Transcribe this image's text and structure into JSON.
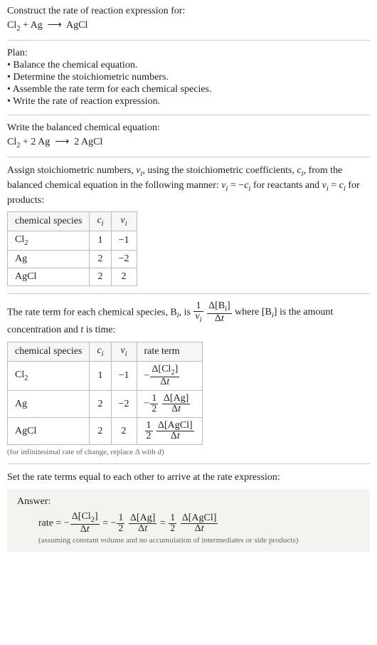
{
  "prompt": {
    "text": "Construct the rate of reaction expression for:",
    "equation_html": "Cl<sub>2</sub> + Ag &nbsp;⟶&nbsp; AgCl"
  },
  "plan": {
    "title": "Plan:",
    "items": [
      "• Balance the chemical equation.",
      "• Determine the stoichiometric numbers.",
      "• Assemble the rate term for each chemical species.",
      "• Write the rate of reaction expression."
    ]
  },
  "balanced": {
    "title": "Write the balanced chemical equation:",
    "equation_html": "Cl<sub>2</sub> + 2 Ag &nbsp;⟶&nbsp; 2 AgCl"
  },
  "stoich": {
    "desc_html": "Assign stoichiometric numbers, <i>ν<sub>i</sub></i>, using the stoichiometric coefficients, <i>c<sub>i</sub></i>, from the balanced chemical equation in the following manner: <i>ν<sub>i</sub></i> = −<i>c<sub>i</sub></i> for reactants and <i>ν<sub>i</sub></i> = <i>c<sub>i</sub></i> for products:",
    "headers": {
      "species": "chemical species",
      "ci_html": "<i>c<sub>i</sub></i>",
      "vi_html": "<i>ν<sub>i</sub></i>"
    },
    "rows": [
      {
        "species_html": "Cl<sub>2</sub>",
        "ci": "1",
        "vi": "−1"
      },
      {
        "species_html": "Ag",
        "ci": "2",
        "vi": "−2"
      },
      {
        "species_html": "AgCl",
        "ci": "2",
        "vi": "2"
      }
    ]
  },
  "rateterm": {
    "desc_prefix": "The rate term for each chemical species, B",
    "desc_mid": ", is ",
    "desc_suffix_html": " where [B<sub><i>i</i></sub>] is the amount concentration and <i>t</i> is time:",
    "headers": {
      "species": "chemical species",
      "ci_html": "<i>c<sub>i</sub></i>",
      "vi_html": "<i>ν<sub>i</sub></i>",
      "rate": "rate term"
    },
    "rows": [
      {
        "species_html": "Cl<sub>2</sub>",
        "ci": "1",
        "vi": "−1",
        "rate_html": "−<span class='frac'><span class='num'>Δ[Cl<sub>2</sub>]</span><span class='den'>Δ<i>t</i></span></span>"
      },
      {
        "species_html": "Ag",
        "ci": "2",
        "vi": "−2",
        "rate_html": "−<span class='frac'><span class='num'>1</span><span class='den'>2</span></span>&nbsp;<span class='frac'><span class='num'>Δ[Ag]</span><span class='den'>Δ<i>t</i></span></span>"
      },
      {
        "species_html": "AgCl",
        "ci": "2",
        "vi": "2",
        "rate_html": "<span class='frac'><span class='num'>1</span><span class='den'>2</span></span>&nbsp;<span class='frac'><span class='num'>Δ[AgCl]</span><span class='den'>Δ<i>t</i></span></span>"
      }
    ],
    "note_html": "(for infinitesimal rate of change, replace Δ with <i>d</i>)"
  },
  "final": {
    "title": "Set the rate terms equal to each other to arrive at the rate expression:",
    "answer_label": "Answer:",
    "answer_html": "rate = −<span class='frac'><span class='num'>Δ[Cl<sub>2</sub>]</span><span class='den'>Δ<i>t</i></span></span> = −<span class='frac'><span class='num'>1</span><span class='den'>2</span></span>&nbsp;<span class='frac'><span class='num'>Δ[Ag]</span><span class='den'>Δ<i>t</i></span></span> = <span class='frac'><span class='num'>1</span><span class='den'>2</span></span>&nbsp;<span class='frac'><span class='num'>Δ[AgCl]</span><span class='den'>Δ<i>t</i></span></span>",
    "answer_sub": "(assuming constant volume and no accumulation of intermediates or side products)"
  }
}
